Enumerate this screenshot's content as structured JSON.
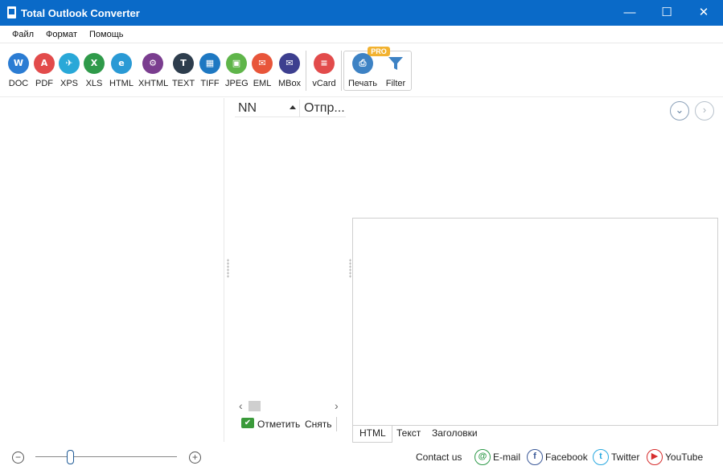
{
  "window": {
    "title": "Total Outlook Converter",
    "minimize": "—",
    "maximize": "☐",
    "close": "✕"
  },
  "menu": [
    "Файл",
    "Формат",
    "Помощь"
  ],
  "toolbar": {
    "formats": [
      {
        "label": "DOC",
        "glyph": "W",
        "color": "#2b7cd3",
        "icon": "word-doc-icon"
      },
      {
        "label": "PDF",
        "glyph": "A",
        "color": "#e24b4b",
        "icon": "pdf-icon"
      },
      {
        "label": "XPS",
        "glyph": "✈",
        "color": "#29a8d8",
        "icon": "xps-icon"
      },
      {
        "label": "XLS",
        "glyph": "X",
        "color": "#2f9a4a",
        "icon": "excel-xls-icon"
      },
      {
        "label": "HTML",
        "glyph": "e",
        "color": "#2a9ad5",
        "icon": "html-icon"
      },
      {
        "label": "XHTML",
        "glyph": "⚙",
        "color": "#7a3d8f",
        "icon": "xhtml-icon"
      },
      {
        "label": "TEXT",
        "glyph": "T",
        "color": "#2d3d4d",
        "icon": "text-icon"
      },
      {
        "label": "TIFF",
        "glyph": "▦",
        "color": "#1e78c2",
        "icon": "tiff-icon"
      },
      {
        "label": "JPEG",
        "glyph": "▣",
        "color": "#5fb54a",
        "icon": "jpeg-icon"
      },
      {
        "label": "EML",
        "glyph": "✉",
        "color": "#e8553a",
        "icon": "eml-icon"
      },
      {
        "label": "MBox",
        "glyph": "✉",
        "color": "#3d3f8f",
        "icon": "mbox-icon"
      }
    ],
    "vcard": {
      "label": "vCard",
      "glyph": "≡",
      "color": "#e24b4b"
    },
    "print": {
      "label": "Печать",
      "glyph": "⎙",
      "color": "#3d82c4"
    },
    "filter": {
      "label": "Filter"
    },
    "pro_badge": "PRO"
  },
  "list": {
    "col_nn": "NN",
    "col_from": "Отпр..."
  },
  "actions": {
    "mark": "Отметить",
    "unmark": "Снять"
  },
  "preview_tabs": [
    "HTML",
    "Текст",
    "Заголовки"
  ],
  "statusbar": {
    "zoom_out": "−",
    "zoom_in": "+",
    "zoom_level": 0.25,
    "contact": "Contact us",
    "links": [
      {
        "label": "E-mail",
        "glyph": "@",
        "color": "#2f9a4a",
        "icon": "email-icon"
      },
      {
        "label": "Facebook",
        "glyph": "f",
        "color": "#3b5998",
        "icon": "facebook-icon"
      },
      {
        "label": "Twitter",
        "glyph": "t",
        "color": "#2aa9e0",
        "icon": "twitter-icon"
      },
      {
        "label": "YouTube",
        "glyph": "▶",
        "color": "#d62d2d",
        "icon": "youtube-icon"
      }
    ]
  }
}
